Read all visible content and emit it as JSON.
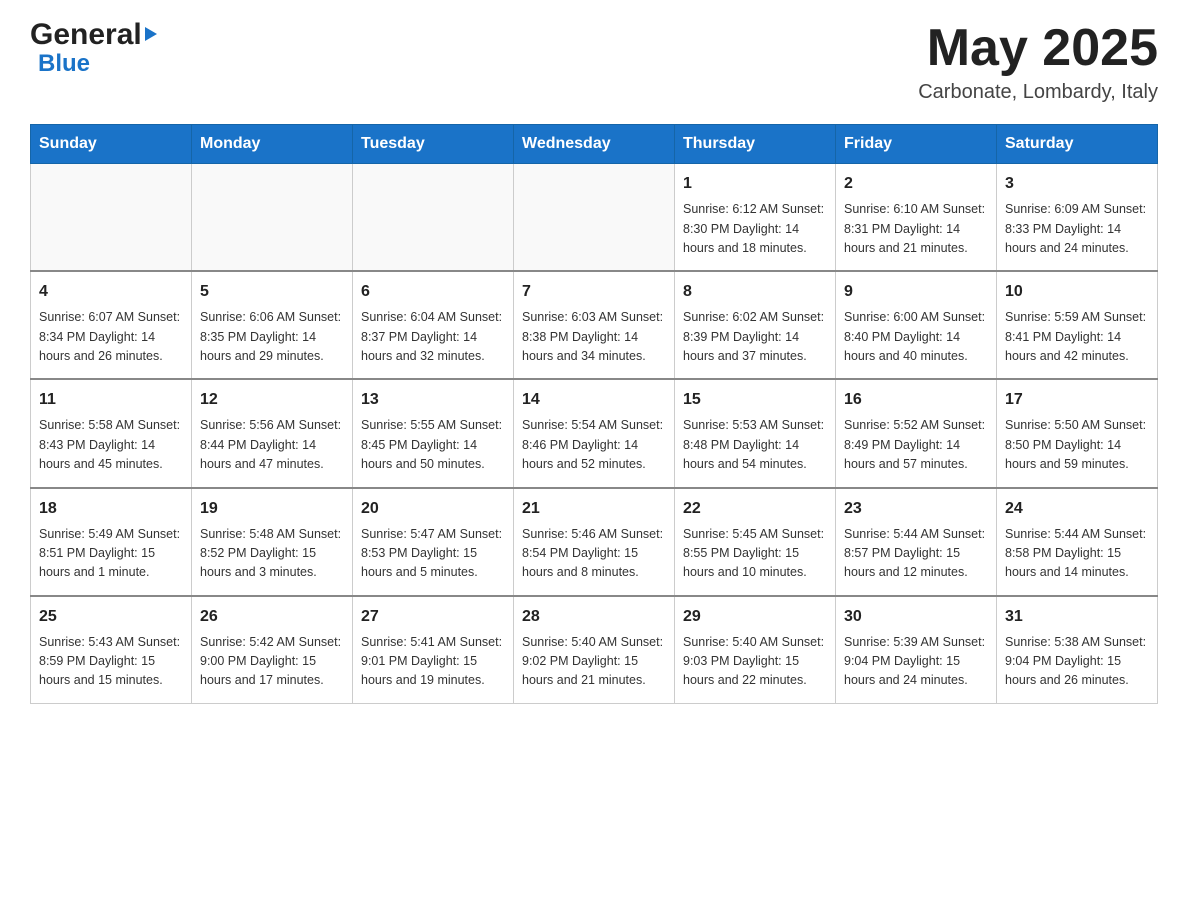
{
  "header": {
    "logo_general": "General",
    "logo_blue": "Blue",
    "month_year": "May 2025",
    "location": "Carbonate, Lombardy, Italy"
  },
  "weekdays": [
    "Sunday",
    "Monday",
    "Tuesday",
    "Wednesday",
    "Thursday",
    "Friday",
    "Saturday"
  ],
  "weeks": [
    [
      {
        "day": "",
        "info": ""
      },
      {
        "day": "",
        "info": ""
      },
      {
        "day": "",
        "info": ""
      },
      {
        "day": "",
        "info": ""
      },
      {
        "day": "1",
        "info": "Sunrise: 6:12 AM\nSunset: 8:30 PM\nDaylight: 14 hours and 18 minutes."
      },
      {
        "day": "2",
        "info": "Sunrise: 6:10 AM\nSunset: 8:31 PM\nDaylight: 14 hours and 21 minutes."
      },
      {
        "day": "3",
        "info": "Sunrise: 6:09 AM\nSunset: 8:33 PM\nDaylight: 14 hours and 24 minutes."
      }
    ],
    [
      {
        "day": "4",
        "info": "Sunrise: 6:07 AM\nSunset: 8:34 PM\nDaylight: 14 hours and 26 minutes."
      },
      {
        "day": "5",
        "info": "Sunrise: 6:06 AM\nSunset: 8:35 PM\nDaylight: 14 hours and 29 minutes."
      },
      {
        "day": "6",
        "info": "Sunrise: 6:04 AM\nSunset: 8:37 PM\nDaylight: 14 hours and 32 minutes."
      },
      {
        "day": "7",
        "info": "Sunrise: 6:03 AM\nSunset: 8:38 PM\nDaylight: 14 hours and 34 minutes."
      },
      {
        "day": "8",
        "info": "Sunrise: 6:02 AM\nSunset: 8:39 PM\nDaylight: 14 hours and 37 minutes."
      },
      {
        "day": "9",
        "info": "Sunrise: 6:00 AM\nSunset: 8:40 PM\nDaylight: 14 hours and 40 minutes."
      },
      {
        "day": "10",
        "info": "Sunrise: 5:59 AM\nSunset: 8:41 PM\nDaylight: 14 hours and 42 minutes."
      }
    ],
    [
      {
        "day": "11",
        "info": "Sunrise: 5:58 AM\nSunset: 8:43 PM\nDaylight: 14 hours and 45 minutes."
      },
      {
        "day": "12",
        "info": "Sunrise: 5:56 AM\nSunset: 8:44 PM\nDaylight: 14 hours and 47 minutes."
      },
      {
        "day": "13",
        "info": "Sunrise: 5:55 AM\nSunset: 8:45 PM\nDaylight: 14 hours and 50 minutes."
      },
      {
        "day": "14",
        "info": "Sunrise: 5:54 AM\nSunset: 8:46 PM\nDaylight: 14 hours and 52 minutes."
      },
      {
        "day": "15",
        "info": "Sunrise: 5:53 AM\nSunset: 8:48 PM\nDaylight: 14 hours and 54 minutes."
      },
      {
        "day": "16",
        "info": "Sunrise: 5:52 AM\nSunset: 8:49 PM\nDaylight: 14 hours and 57 minutes."
      },
      {
        "day": "17",
        "info": "Sunrise: 5:50 AM\nSunset: 8:50 PM\nDaylight: 14 hours and 59 minutes."
      }
    ],
    [
      {
        "day": "18",
        "info": "Sunrise: 5:49 AM\nSunset: 8:51 PM\nDaylight: 15 hours and 1 minute."
      },
      {
        "day": "19",
        "info": "Sunrise: 5:48 AM\nSunset: 8:52 PM\nDaylight: 15 hours and 3 minutes."
      },
      {
        "day": "20",
        "info": "Sunrise: 5:47 AM\nSunset: 8:53 PM\nDaylight: 15 hours and 5 minutes."
      },
      {
        "day": "21",
        "info": "Sunrise: 5:46 AM\nSunset: 8:54 PM\nDaylight: 15 hours and 8 minutes."
      },
      {
        "day": "22",
        "info": "Sunrise: 5:45 AM\nSunset: 8:55 PM\nDaylight: 15 hours and 10 minutes."
      },
      {
        "day": "23",
        "info": "Sunrise: 5:44 AM\nSunset: 8:57 PM\nDaylight: 15 hours and 12 minutes."
      },
      {
        "day": "24",
        "info": "Sunrise: 5:44 AM\nSunset: 8:58 PM\nDaylight: 15 hours and 14 minutes."
      }
    ],
    [
      {
        "day": "25",
        "info": "Sunrise: 5:43 AM\nSunset: 8:59 PM\nDaylight: 15 hours and 15 minutes."
      },
      {
        "day": "26",
        "info": "Sunrise: 5:42 AM\nSunset: 9:00 PM\nDaylight: 15 hours and 17 minutes."
      },
      {
        "day": "27",
        "info": "Sunrise: 5:41 AM\nSunset: 9:01 PM\nDaylight: 15 hours and 19 minutes."
      },
      {
        "day": "28",
        "info": "Sunrise: 5:40 AM\nSunset: 9:02 PM\nDaylight: 15 hours and 21 minutes."
      },
      {
        "day": "29",
        "info": "Sunrise: 5:40 AM\nSunset: 9:03 PM\nDaylight: 15 hours and 22 minutes."
      },
      {
        "day": "30",
        "info": "Sunrise: 5:39 AM\nSunset: 9:04 PM\nDaylight: 15 hours and 24 minutes."
      },
      {
        "day": "31",
        "info": "Sunrise: 5:38 AM\nSunset: 9:04 PM\nDaylight: 15 hours and 26 minutes."
      }
    ]
  ]
}
